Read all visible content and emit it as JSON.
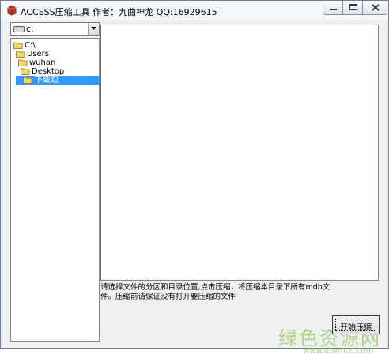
{
  "window": {
    "title": "ACCESS压缩工具  作者：九曲神龙 QQ:16929615"
  },
  "drive_select": {
    "value": "c:"
  },
  "directory_tree": {
    "items": [
      {
        "label": "C:\\",
        "selected": false
      },
      {
        "label": "Users",
        "selected": false
      },
      {
        "label": "wuhan",
        "selected": false
      },
      {
        "label": "Desktop",
        "selected": false
      },
      {
        "label": "下载包",
        "selected": true
      }
    ]
  },
  "info_text": "请选择文件的分区和目录位置,点击压缩，将压缩本目录下所有mdb文件。压缩前请保证没有打开要压缩的文件",
  "start_button": {
    "label": "开始压缩"
  },
  "watermark": {
    "text": "绿色资源网",
    "url": "www.downcc.com"
  },
  "colors": {
    "selection": "#3399ff",
    "folder": "#f5d76e"
  }
}
